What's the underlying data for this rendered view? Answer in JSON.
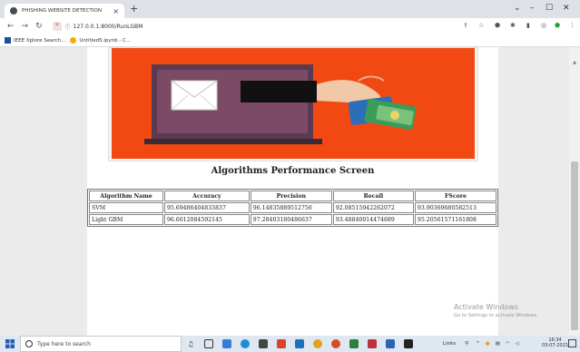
{
  "browser": {
    "tab_title": "PHISHING WEBSITE DETECTION",
    "tab_close": "×",
    "new_tab": "+",
    "url_badge": "ঙ্গ",
    "url": "127.0.0.1:8000/RunLGBM",
    "bookmarks": [
      {
        "label": "IEEE Xplore Search..."
      },
      {
        "label": "Untitled5.ipynb - C..."
      }
    ],
    "window_controls": [
      "⌄",
      "–",
      "☐",
      "✕"
    ]
  },
  "page": {
    "heading": "Algorithms Performance Screen",
    "table": {
      "headers": [
        "Algorithm Name",
        "Accuracy",
        "Precision",
        "Recall",
        "FScore"
      ],
      "rows": [
        [
          "SVM",
          "95.69486404833837",
          "96.14835889512756",
          "92.08515942262072",
          "93.90369680582513"
        ],
        [
          "Light GBM",
          "96.6012084592145",
          "97.28403180486637",
          "93.48840014474689",
          "95.20561571161808"
        ]
      ]
    },
    "watermark_title": "Activate Windows",
    "watermark_sub": "Go to Settings to activate Windows."
  },
  "taskbar": {
    "search_placeholder": "Type here to search",
    "tray_links": "Links",
    "time": "16:34",
    "date": "03-07-2021"
  },
  "colors": {
    "banner": "#f24913",
    "page_bg": "#ebebeb",
    "taskbar": "#dfe7f0"
  }
}
